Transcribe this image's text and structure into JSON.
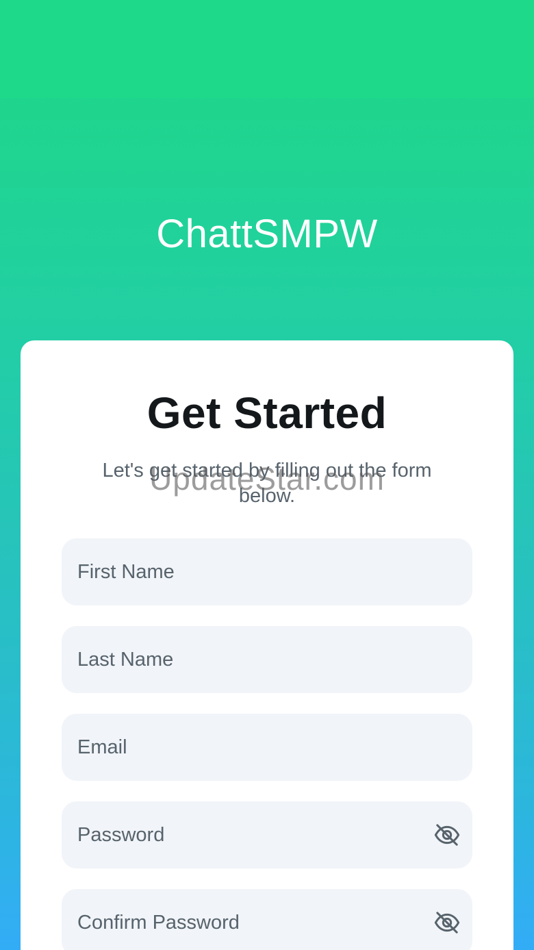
{
  "header": {
    "app_title": "ChattSMPW"
  },
  "watermark": "UpdateStar.com",
  "form": {
    "title": "Get Started",
    "subtitle": "Let's get started by filling out the form below.",
    "fields": {
      "first_name": {
        "placeholder": "First Name",
        "value": ""
      },
      "last_name": {
        "placeholder": "Last Name",
        "value": ""
      },
      "email": {
        "placeholder": "Email",
        "value": ""
      },
      "password": {
        "placeholder": "Password",
        "value": "",
        "toggle_icon": "eye-off-icon"
      },
      "confirm_password": {
        "placeholder": "Confirm Password",
        "value": "",
        "toggle_icon": "eye-off-icon"
      }
    }
  },
  "colors": {
    "gradient_top": "#1ed98a",
    "gradient_bottom": "#33acf7",
    "card_bg": "#ffffff",
    "field_bg": "#f1f4f8",
    "title_text": "#14181b",
    "secondary_text": "#57636c"
  }
}
